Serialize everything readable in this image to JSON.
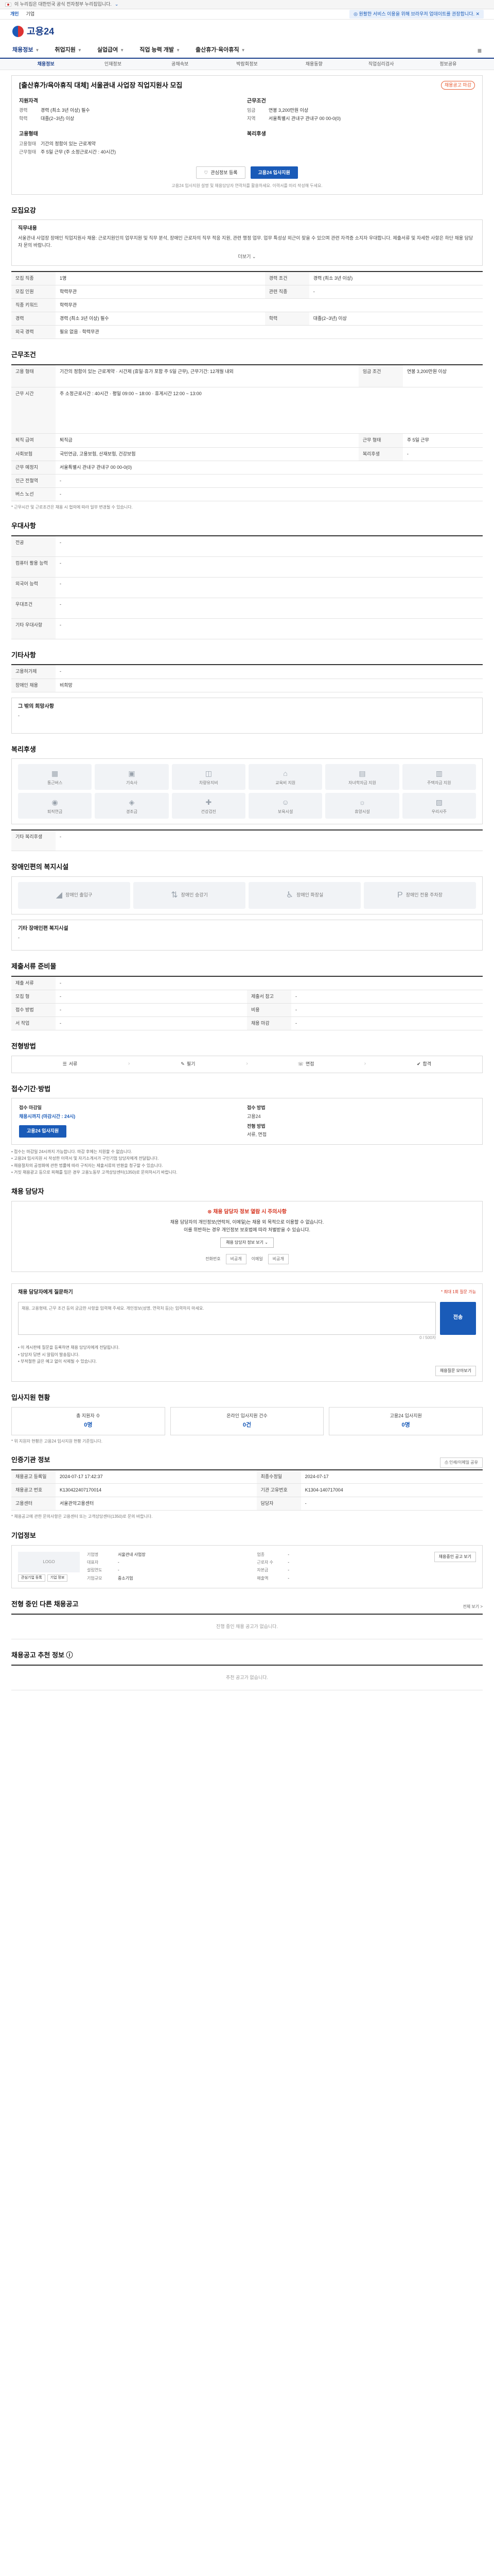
{
  "banner": {
    "text": "이 누리집은 대한민국 공식 전자정부 누리집입니다.",
    "expand": "⌄"
  },
  "util": {
    "tabs": [
      "개인",
      "기업"
    ],
    "notice": "◎ 원활한 서비스 이용을 위해 브라우저 업데이트를 권장합니다. ✕"
  },
  "logo": {
    "text": "고용24"
  },
  "gnb": {
    "items": [
      "채용정보",
      "취업지원",
      "실업급여",
      "직업 능력 개발",
      "출산휴가·육아휴직"
    ],
    "menu_icon": "≡"
  },
  "subnav": {
    "items": [
      "채용정보",
      "인재정보",
      "공채속보",
      "박람회정보",
      "채용동향",
      "직업심리검사",
      "정보공유"
    ]
  },
  "summary": {
    "title": "[출산휴가/육아휴직 대체] 서울관내 사업장 직업지원사 모집",
    "badge": "채용공고 마감",
    "left_head": "지원자격",
    "left": [
      {
        "k": "경력",
        "v": "경력 (최소 3년 이상) 필수"
      },
      {
        "k": "학력",
        "v": "대졸(2~3년) 이상"
      }
    ],
    "right_head": "근무조건",
    "right": [
      {
        "k": "임금",
        "v": "연봉 3,200만원 이상"
      },
      {
        "k": "지역",
        "v": "서울특별시 관내구 관내구 00 00-0(0)"
      }
    ],
    "left_head2": "고용형태",
    "left2": [
      {
        "k": "고용형태",
        "v": "기간의 정함이 있는 근로계약"
      },
      {
        "k": "근무형태",
        "v": "주 5일 근무 (주 소정근로시간 : 40시간)"
      }
    ],
    "right_head2": "복리후생",
    "btn_scrap": "관심정보 등록",
    "btn_apply": "고용24 입사지원",
    "hint": "고용24 입사지원 설명 및 채용담당자 연락처를 활용하세요. 이력서를 미리 작성해 두세요."
  },
  "recruit": {
    "title": "모집요강",
    "box_head": "직무내용",
    "desc": "서울관내 사업장 장애인 직업지원사 채용: 근로지원인의 업무지원 및 직무 분석, 장애인 근로자의 직무 적응 지원, 관련 행정 업무. 업무 특성상 외근이 잦을 수 있으며 관련 자격증 소지자 우대합니다. 제출서류 및 자세한 사항은 하단 채용 담당자 문의 바랍니다.",
    "more": "더보기 ⌄",
    "rows": [
      {
        "k": "모집 직종",
        "v": "1명",
        "k2": "경력 조건",
        "v2": "경력 (최소 3년 이상)"
      },
      {
        "k": "모집 인원",
        "v": "학력무관",
        "k2": "관련 직종",
        "v2": "-"
      },
      {
        "k": "직종 키워드",
        "v": "학력무관",
        "k2": "",
        "v2": ""
      },
      {
        "k": "경력",
        "v": "경력 (최소 3년 이상) 필수",
        "k2": "학력",
        "v2": "대졸(2~3년) 이상"
      },
      {
        "k": "외국 경력",
        "v": "필요 없음   ·   학력무관",
        "k2": "",
        "v2": ""
      }
    ]
  },
  "work": {
    "title": "근무조건",
    "rows": [
      {
        "k": "고용 형태",
        "v": "기간의 정함이 있는 근로계약 · 시간제 (휴일·휴가 포함 주 5일 근무), 근무기간: 12개월 내외",
        "k2": "임금 조건",
        "v2": "연봉 3,200만원 이상"
      },
      {
        "k": "근무 시간",
        "v": "주 소정근로시간 : 40시간 · 평일 09:00 ~ 18:00 · 휴게시간 12:00 ~ 13:00",
        "k2": "",
        "v2": ""
      },
      {
        "k": "퇴직 급여",
        "v": "퇴직금",
        "k2": "근무 형태",
        "v2": "주 5일 근무"
      },
      {
        "k": "사회보험",
        "v": "국민연금, 고용보험, 산재보험, 건강보험",
        "k2": "복리후생",
        "v2": "-"
      },
      {
        "k": "근무 예정지",
        "v": "서울특별시 관내구 관내구 00 00-0(0)",
        "k2": "",
        "v2": ""
      },
      {
        "k": "인근 전철역",
        "v": "-",
        "k2": "",
        "v2": ""
      },
      {
        "k": "버스 노선",
        "v": "-",
        "k2": "",
        "v2": ""
      }
    ],
    "note": "* 근무시간 및 근로조건은 채용 시 협의에 따라 일부 변경될 수 있습니다."
  },
  "prefer": {
    "title": "우대사항",
    "rows": [
      {
        "k": "전공",
        "v": "-"
      },
      {
        "k": "컴퓨터 활용 능력",
        "v": "-"
      },
      {
        "k": "외국어 능력",
        "v": "-"
      },
      {
        "k": "우대조건",
        "v": "-"
      },
      {
        "k": "기타 우대사항",
        "v": "-"
      }
    ]
  },
  "etc": {
    "title": "기타사항",
    "rows": [
      {
        "k": "고용허가제",
        "v": "-"
      },
      {
        "k": "장애인 채용",
        "v": "비희망"
      }
    ],
    "note": "그 밖의 희망사항",
    "note_v": "-"
  },
  "welfare": {
    "title": "복리후생",
    "icons": [
      {
        "icon": "building-icon",
        "g": "▦",
        "label": "통근버스"
      },
      {
        "icon": "bus-icon",
        "g": "▣",
        "label": "기숙사"
      },
      {
        "icon": "meal-icon",
        "g": "◫",
        "label": "차량유지비"
      },
      {
        "icon": "house-icon",
        "g": "⌂",
        "label": "교육비 지원"
      },
      {
        "icon": "car-icon",
        "g": "▤",
        "label": "자녀학자금 지원"
      },
      {
        "icon": "book-icon",
        "g": "▥",
        "label": "주택자금 지원"
      },
      {
        "icon": "coin-icon",
        "g": "◉",
        "label": "퇴직연금"
      },
      {
        "icon": "gift-icon",
        "g": "◈",
        "label": "경조금"
      },
      {
        "icon": "health-icon",
        "g": "✚",
        "label": "건강검진"
      },
      {
        "icon": "child-icon",
        "g": "☺",
        "label": "보육시설"
      },
      {
        "icon": "vacation-icon",
        "g": "☼",
        "label": "휴양시설"
      },
      {
        "icon": "bank-icon",
        "g": "▧",
        "label": "우리사주"
      }
    ],
    "other_k": "기타 복리후생",
    "other_v": "-"
  },
  "disability": {
    "title": "장애인편의 복지시설",
    "icons": [
      {
        "icon": "ramp-icon",
        "g": "◢",
        "label": "장애인 출입구"
      },
      {
        "icon": "elevator-icon",
        "g": "⇅",
        "label": "장애인 승강기"
      },
      {
        "icon": "toilet-icon",
        "g": "♿",
        "label": "장애인 화장실"
      },
      {
        "icon": "parking-icon",
        "g": "P",
        "label": "장애인 전용 주차장"
      }
    ],
    "other_k": "기타 장애인편 복지시설",
    "other_v": "-"
  },
  "docs": {
    "title": "제출서류 준비물",
    "rows": [
      {
        "k": "제출 서류",
        "v": "-",
        "k2": "",
        "v2": ""
      },
      {
        "k": "모집 형",
        "v": "-",
        "k2": "제출서 참고",
        "v2": "-"
      },
      {
        "k": "접수 방법",
        "v": "-",
        "k2": "비용",
        "v2": "-"
      },
      {
        "k": "서 작업",
        "v": "-",
        "k2": "채용 마감",
        "v2": "-"
      }
    ]
  },
  "process": {
    "title": "전형방법",
    "steps": [
      {
        "icon": "doc-icon",
        "g": "☰",
        "label": "서류"
      },
      {
        "icon": "pen-icon",
        "g": "✎",
        "label": "필기"
      },
      {
        "icon": "talk-icon",
        "g": "☏",
        "label": "면접"
      },
      {
        "icon": "check-icon",
        "g": "✔",
        "label": "합격"
      }
    ]
  },
  "apply": {
    "title": "접수기간·방법",
    "col1_lbl": "접수 마감일",
    "col1_val": "채용시까지 (마감시간 : 24시)",
    "col2_lbl": "접수 방법",
    "col2_val": "고용24",
    "col2_lbl2": "전형 방법",
    "col2_val2": "서류, 면접",
    "btn": "고용24 입사지원",
    "bullets": [
      "• 접수는 마감일 24시까지 가능합니다. 마감 후에는 지원할 수 없습니다.",
      "• 고용24 입사지원 시 작성한 이력서 및 자기소개서가 구인기업 담당자에게 전달됩니다.",
      "• 채용절차의 공정화에 관한 법률에 따라 구직자는 제출서류의 반환을 청구할 수 있습니다.",
      "• 거짓 채용광고 등으로 피해를 입은 경우 고용노동부 고객상담센터(1350)로 문의하시기 바랍니다."
    ]
  },
  "contact": {
    "title": "채용 담당자",
    "warn": "⊗ 채용 담당자 정보 열람 시 주의사항",
    "warn_sub": "채용 담당자의 개인정보(연락처, 이메일)는 채용 외 목적으로 이용할 수 없습니다.",
    "warn_sub2": "이를 위반하는 경우 개인정보 보호법에 따라 처벌받을 수 있습니다.",
    "warn_btn": "채용 담당자 정보 보기 ⌄",
    "fields": [
      {
        "k": "전화번호",
        "v": "비공개"
      },
      {
        "k": "이메일",
        "v": "비공개"
      }
    ]
  },
  "qa": {
    "head": "채용 담당자에게 질문하기",
    "limit": "* 최대 1회 질문 가능",
    "placeholder": "채용, 고용형태, 근무 조건 등의 궁금한 사항을 입력해 주세요. 개인정보(성명, 연락처 등)는 입력하지 마세요.",
    "count": "0 / 500자",
    "btn": "전송",
    "bullets": [
      "• 이 게시판에 질문을 등록하면 채용 담당자에게 전달됩니다.",
      "• 담당자 답변 시 알림이 발송됩니다.",
      "• 부적절한 글은 예고 없이 삭제될 수 있습니다."
    ],
    "link": "채용질문 모아보기"
  },
  "status": {
    "title": "입사지원 현황",
    "stats": [
      {
        "l": "총 지원자 수",
        "n": "0명"
      },
      {
        "l": "온라인 입사지원 건수",
        "n": "0건"
      },
      {
        "l": "고용24 입사지원",
        "n": "0명"
      }
    ],
    "note": "* 위 지원자 현황은 고용24 입사지원 현황 기준입니다."
  },
  "job_info": {
    "title": "인증기관 정보",
    "btn": "⎙ 인쇄/이메일 공유",
    "rows": [
      {
        "k": "채용공고 등록일",
        "v": "2024-07-17 17:42:37",
        "k2": "최종수정일",
        "v2": "2024-07-17"
      },
      {
        "k": "채용공고 번호",
        "v": "K130422407170014",
        "k2": "기관 고유번호",
        "v2": "K1304-140717004"
      },
      {
        "k": "고용센터",
        "v": "서울관악고용센터",
        "k2": "담당자",
        "v2": "-"
      }
    ],
    "note": "* 채용공고에 관한 문의사항은 고용센터 또는 고객상담센터(1350)로 문의 바랍니다."
  },
  "company": {
    "title": "기업정보",
    "logo_text": "LOGO",
    "btns": [
      "관심기업 등록",
      "기업 정보"
    ],
    "info": [
      {
        "k": "기업명",
        "v": "서울관내 사업장"
      },
      {
        "k": "업종",
        "v": "-"
      },
      {
        "k": "대표자",
        "v": "-"
      },
      {
        "k": "근로자 수",
        "v": "-"
      },
      {
        "k": "설립연도",
        "v": "-"
      },
      {
        "k": "자본금",
        "v": "-"
      },
      {
        "k": "기업규모",
        "v": "중소기업"
      },
      {
        "k": "매출액",
        "v": "-"
      }
    ],
    "action": "채용중인 공고 보기"
  },
  "similar": {
    "title": "전형 중인 다른 채용공고",
    "link": "전체 보기 >",
    "empty": "진행 중인 채용 공고가 없습니다."
  },
  "recommend": {
    "title": "채용공고 추천 정보 ⓘ",
    "empty": "추천 공고가 없습니다."
  }
}
